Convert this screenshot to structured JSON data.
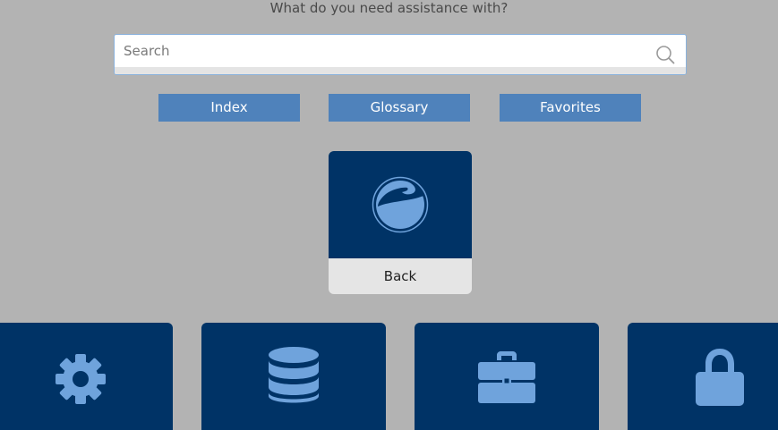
{
  "header": {
    "prompt": "What do you need assistance with?"
  },
  "search": {
    "placeholder": "Search",
    "value": "",
    "icon": "search-icon"
  },
  "nav": {
    "index_label": "Index",
    "glossary_label": "Glossary",
    "favorites_label": "Favorites"
  },
  "back_tile": {
    "label": "Back",
    "icon": "globe-icon"
  },
  "categories": [
    {
      "icon": "gear-icon"
    },
    {
      "icon": "database-icon"
    },
    {
      "icon": "briefcase-icon"
    },
    {
      "icon": "lock-icon"
    }
  ],
  "colors": {
    "background": "#b3b3b3",
    "tile_dark": "#003366",
    "button_blue": "#4f82bb",
    "icon_light_blue": "#6fa3dc",
    "tile_label_bg": "#e5e5e5"
  }
}
